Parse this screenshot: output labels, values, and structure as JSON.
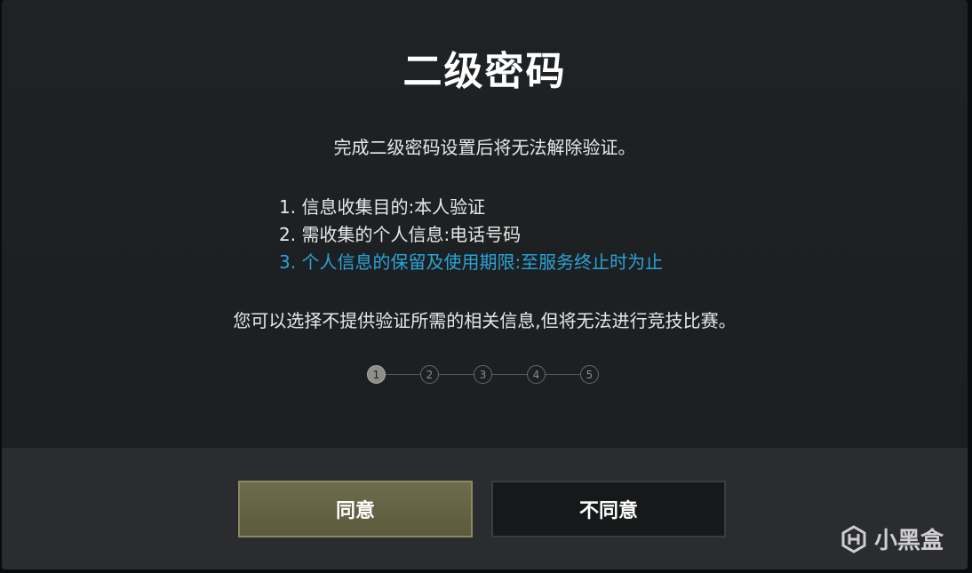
{
  "dialog": {
    "title": "二级密码",
    "subtitle": "完成二级密码设置后将无法解除验证。",
    "info_items": [
      "1. 信息收集目的:本人验证",
      "2. 需收集的个人信息:电话号码",
      "3. 个人信息的保留及使用期限:至服务终止时为止"
    ],
    "notice": "您可以选择不提供验证所需的相关信息,但将无法进行竞技比赛。",
    "steps": [
      "1",
      "2",
      "3",
      "4",
      "5"
    ],
    "current_step": 1
  },
  "buttons": {
    "agree_label": "同意",
    "disagree_label": "不同意"
  },
  "watermark": {
    "text": "小黑盒"
  },
  "colors": {
    "highlight": "#2aa3d6",
    "agree_button": "#6f6c4b",
    "background": "#1d2022"
  }
}
